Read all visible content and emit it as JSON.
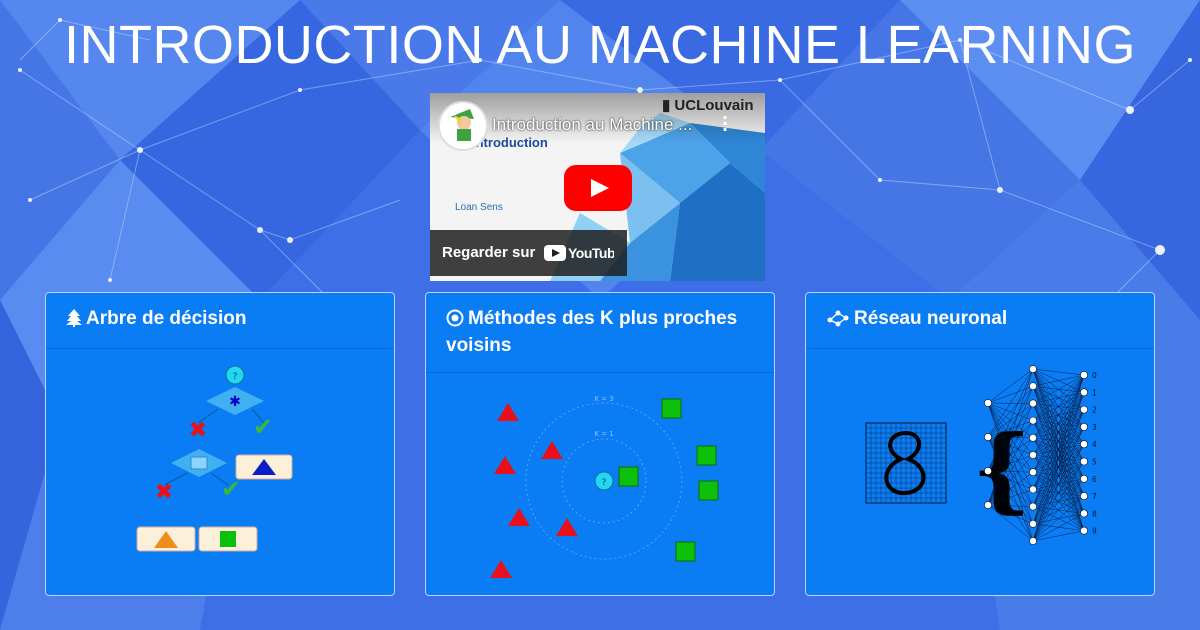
{
  "page_title": "INTRODUCTION AU MACHINE LEARNING",
  "video": {
    "title": "Introduction au Machine ...",
    "channel_brand": "UCLouvain",
    "slide_title": "Introduction",
    "slide_author": "Loan Sens",
    "watch_label": "Regarder sur",
    "watch_brand": "YouTube"
  },
  "cards": [
    {
      "title": "Arbre de décision",
      "icon": "tree-icon"
    },
    {
      "title": "Méthodes des K plus proches voisins",
      "icon": "target-circle-icon"
    },
    {
      "title": "Réseau neuronal",
      "icon": "network-nodes-icon"
    }
  ],
  "knn": {
    "k3_label": "K = 3",
    "k1_label": "K = 1",
    "query_label": "?"
  },
  "tree": {
    "query_label": "?"
  },
  "nn": {
    "outputs": [
      "0",
      "1",
      "2",
      "3",
      "4",
      "5",
      "6",
      "7",
      "8",
      "9"
    ]
  },
  "colors": {
    "card_bg": "#0a7df4",
    "page_bg": "#3f6fe6",
    "class_a": "#e8101a",
    "class_b": "#0bbf0b"
  }
}
